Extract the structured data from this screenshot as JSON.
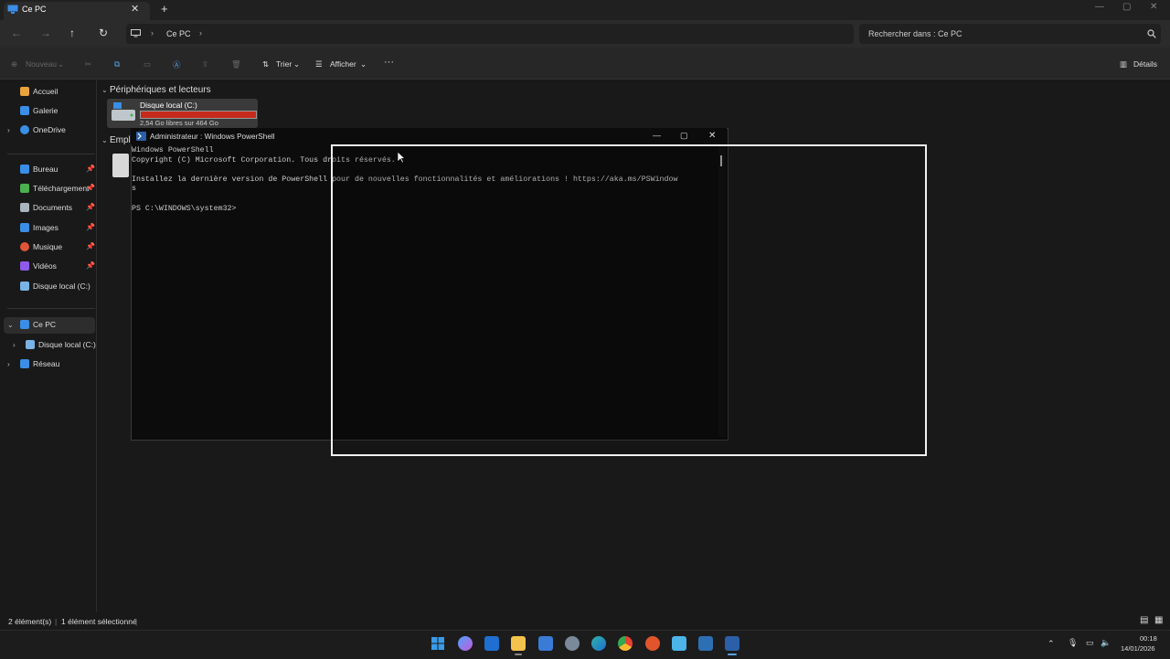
{
  "window": {
    "tab_title": "Ce PC",
    "new_tab": "+",
    "tab_close": "✕",
    "minimize": "—",
    "maximize": "▢",
    "close": "✕"
  },
  "address": {
    "breadcrumb_root": "Ce PC",
    "search_placeholder": "Rechercher dans : Ce PC"
  },
  "toolbar": {
    "new_label": "Nouveau",
    "sort_label": "Trier",
    "view_label": "Afficher",
    "more_label": "···",
    "details_label": "Détails"
  },
  "sidebar": {
    "items": [
      {
        "label": "Accueil",
        "icon": "home-icon",
        "color": "#e8a33c"
      },
      {
        "label": "Galerie",
        "icon": "gallery-icon",
        "color": "#3a8ee6"
      },
      {
        "label": "OneDrive",
        "icon": "cloud-icon",
        "color": "#3a8ee6"
      },
      {
        "label": "Bureau",
        "icon": "desktop-icon",
        "color": "#3a8ee6"
      },
      {
        "label": "Téléchargement",
        "icon": "download-icon",
        "color": "#4caf50"
      },
      {
        "label": "Documents",
        "icon": "document-icon",
        "color": "#aab4be"
      },
      {
        "label": "Images",
        "icon": "image-icon",
        "color": "#3a8ee6"
      },
      {
        "label": "Musique",
        "icon": "music-icon",
        "color": "#e0553a"
      },
      {
        "label": "Vidéos",
        "icon": "video-icon",
        "color": "#8e5ae8"
      },
      {
        "label": "Disque local (C:)",
        "icon": "drive-icon",
        "color": "#7ab3e8"
      },
      {
        "label": "Ce PC",
        "icon": "pc-icon",
        "color": "#3a8ee6"
      },
      {
        "label": "Disque local (C:)",
        "icon": "drive-icon",
        "color": "#7ab3e8"
      },
      {
        "label": "Réseau",
        "icon": "network-icon",
        "color": "#3a8ee6"
      }
    ]
  },
  "content": {
    "group_devices": "Périphériques et lecteurs",
    "group_locations": "Empl",
    "drive_name": "Disque local (C:)",
    "drive_free": "2,54 Go libres sur 464 Go",
    "drive_used_fraction": 0.995
  },
  "powershell": {
    "title": "Administrateur : Windows PowerShell",
    "line1": "Windows PowerShell",
    "line2": "Copyright (C) Microsoft Corporation. Tous droits réservés.",
    "line3": "Installez la dernière version de PowerShell pour de nouvelles fonctionnalités et améliorations ! https://aka.ms/PSWindow",
    "line4": "s",
    "prompt": "PS C:\\WINDOWS\\system32>"
  },
  "status": {
    "count": "2 élément(s)",
    "selected": "1 élément sélectionné"
  },
  "taskbar": {
    "time": "00:18",
    "date": "14/01/2026"
  }
}
